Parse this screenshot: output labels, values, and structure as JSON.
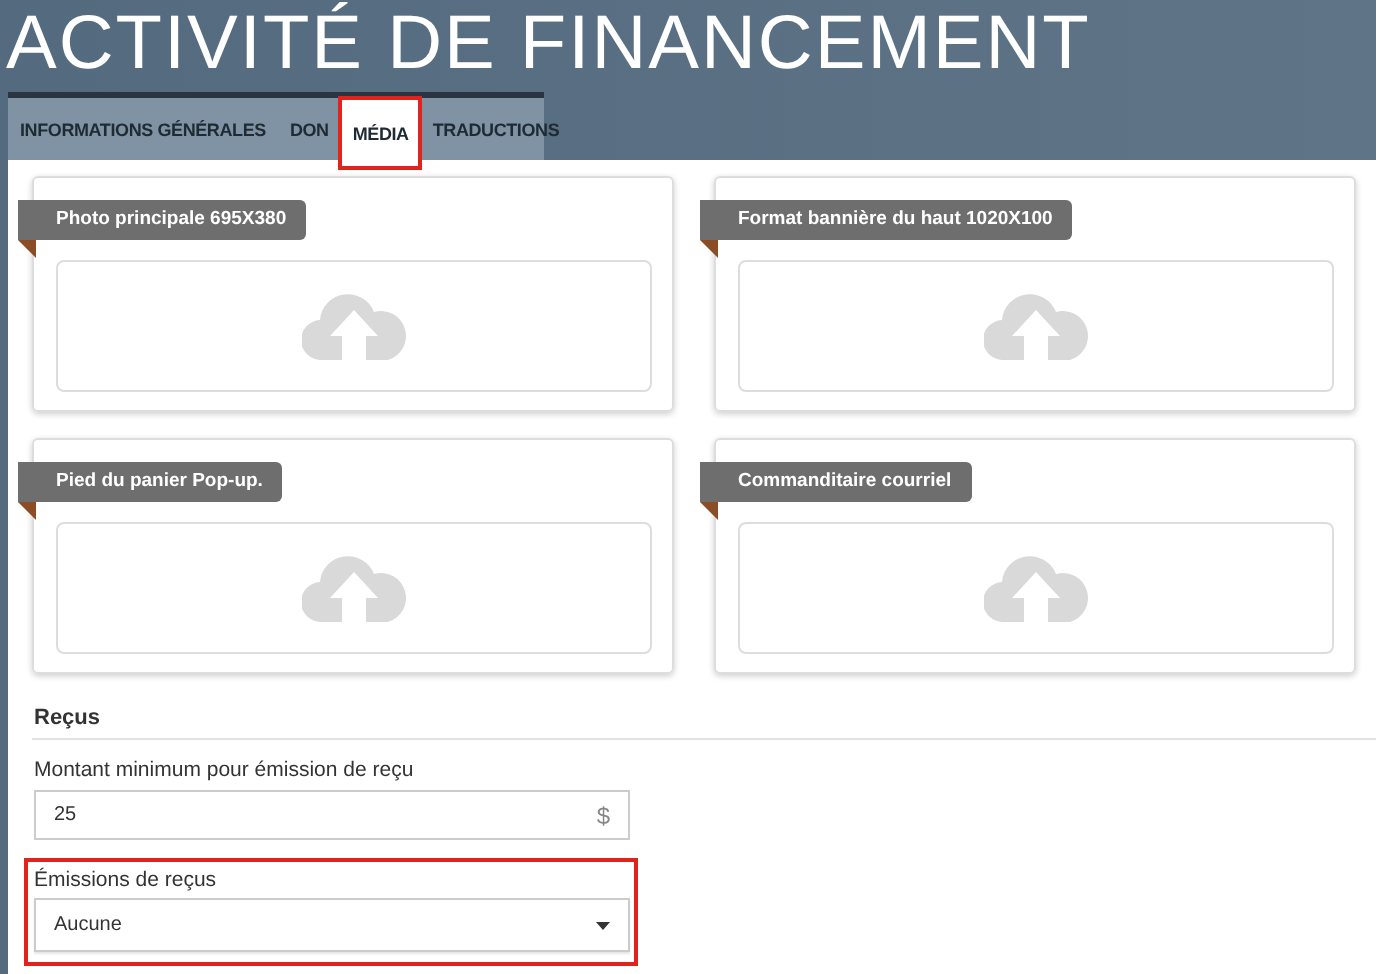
{
  "page": {
    "title": "ACTIVITÉ DE FINANCEMENT"
  },
  "tabs": [
    {
      "label": "INFORMATIONS GÉNÉRALES",
      "selected": false,
      "highlighted": false
    },
    {
      "label": "DON",
      "selected": false,
      "highlighted": false
    },
    {
      "label": "MÉDIA",
      "selected": true,
      "highlighted": true
    },
    {
      "label": "TRADUCTIONS",
      "selected": false,
      "highlighted": false
    }
  ],
  "media_cards": [
    {
      "label": "Photo principale 695X380"
    },
    {
      "label": "Format bannière du haut 1020X100"
    },
    {
      "label": "Pied du panier Pop-up."
    },
    {
      "label": "Commanditaire courriel"
    }
  ],
  "receipts": {
    "heading": "Reçus",
    "minimum_amount": {
      "label": "Montant minimum pour émission de reçu",
      "value": "25",
      "unit": "$"
    },
    "issuance": {
      "label": "Émissions de reçus",
      "value": "Aucune",
      "highlighted": true
    }
  }
}
